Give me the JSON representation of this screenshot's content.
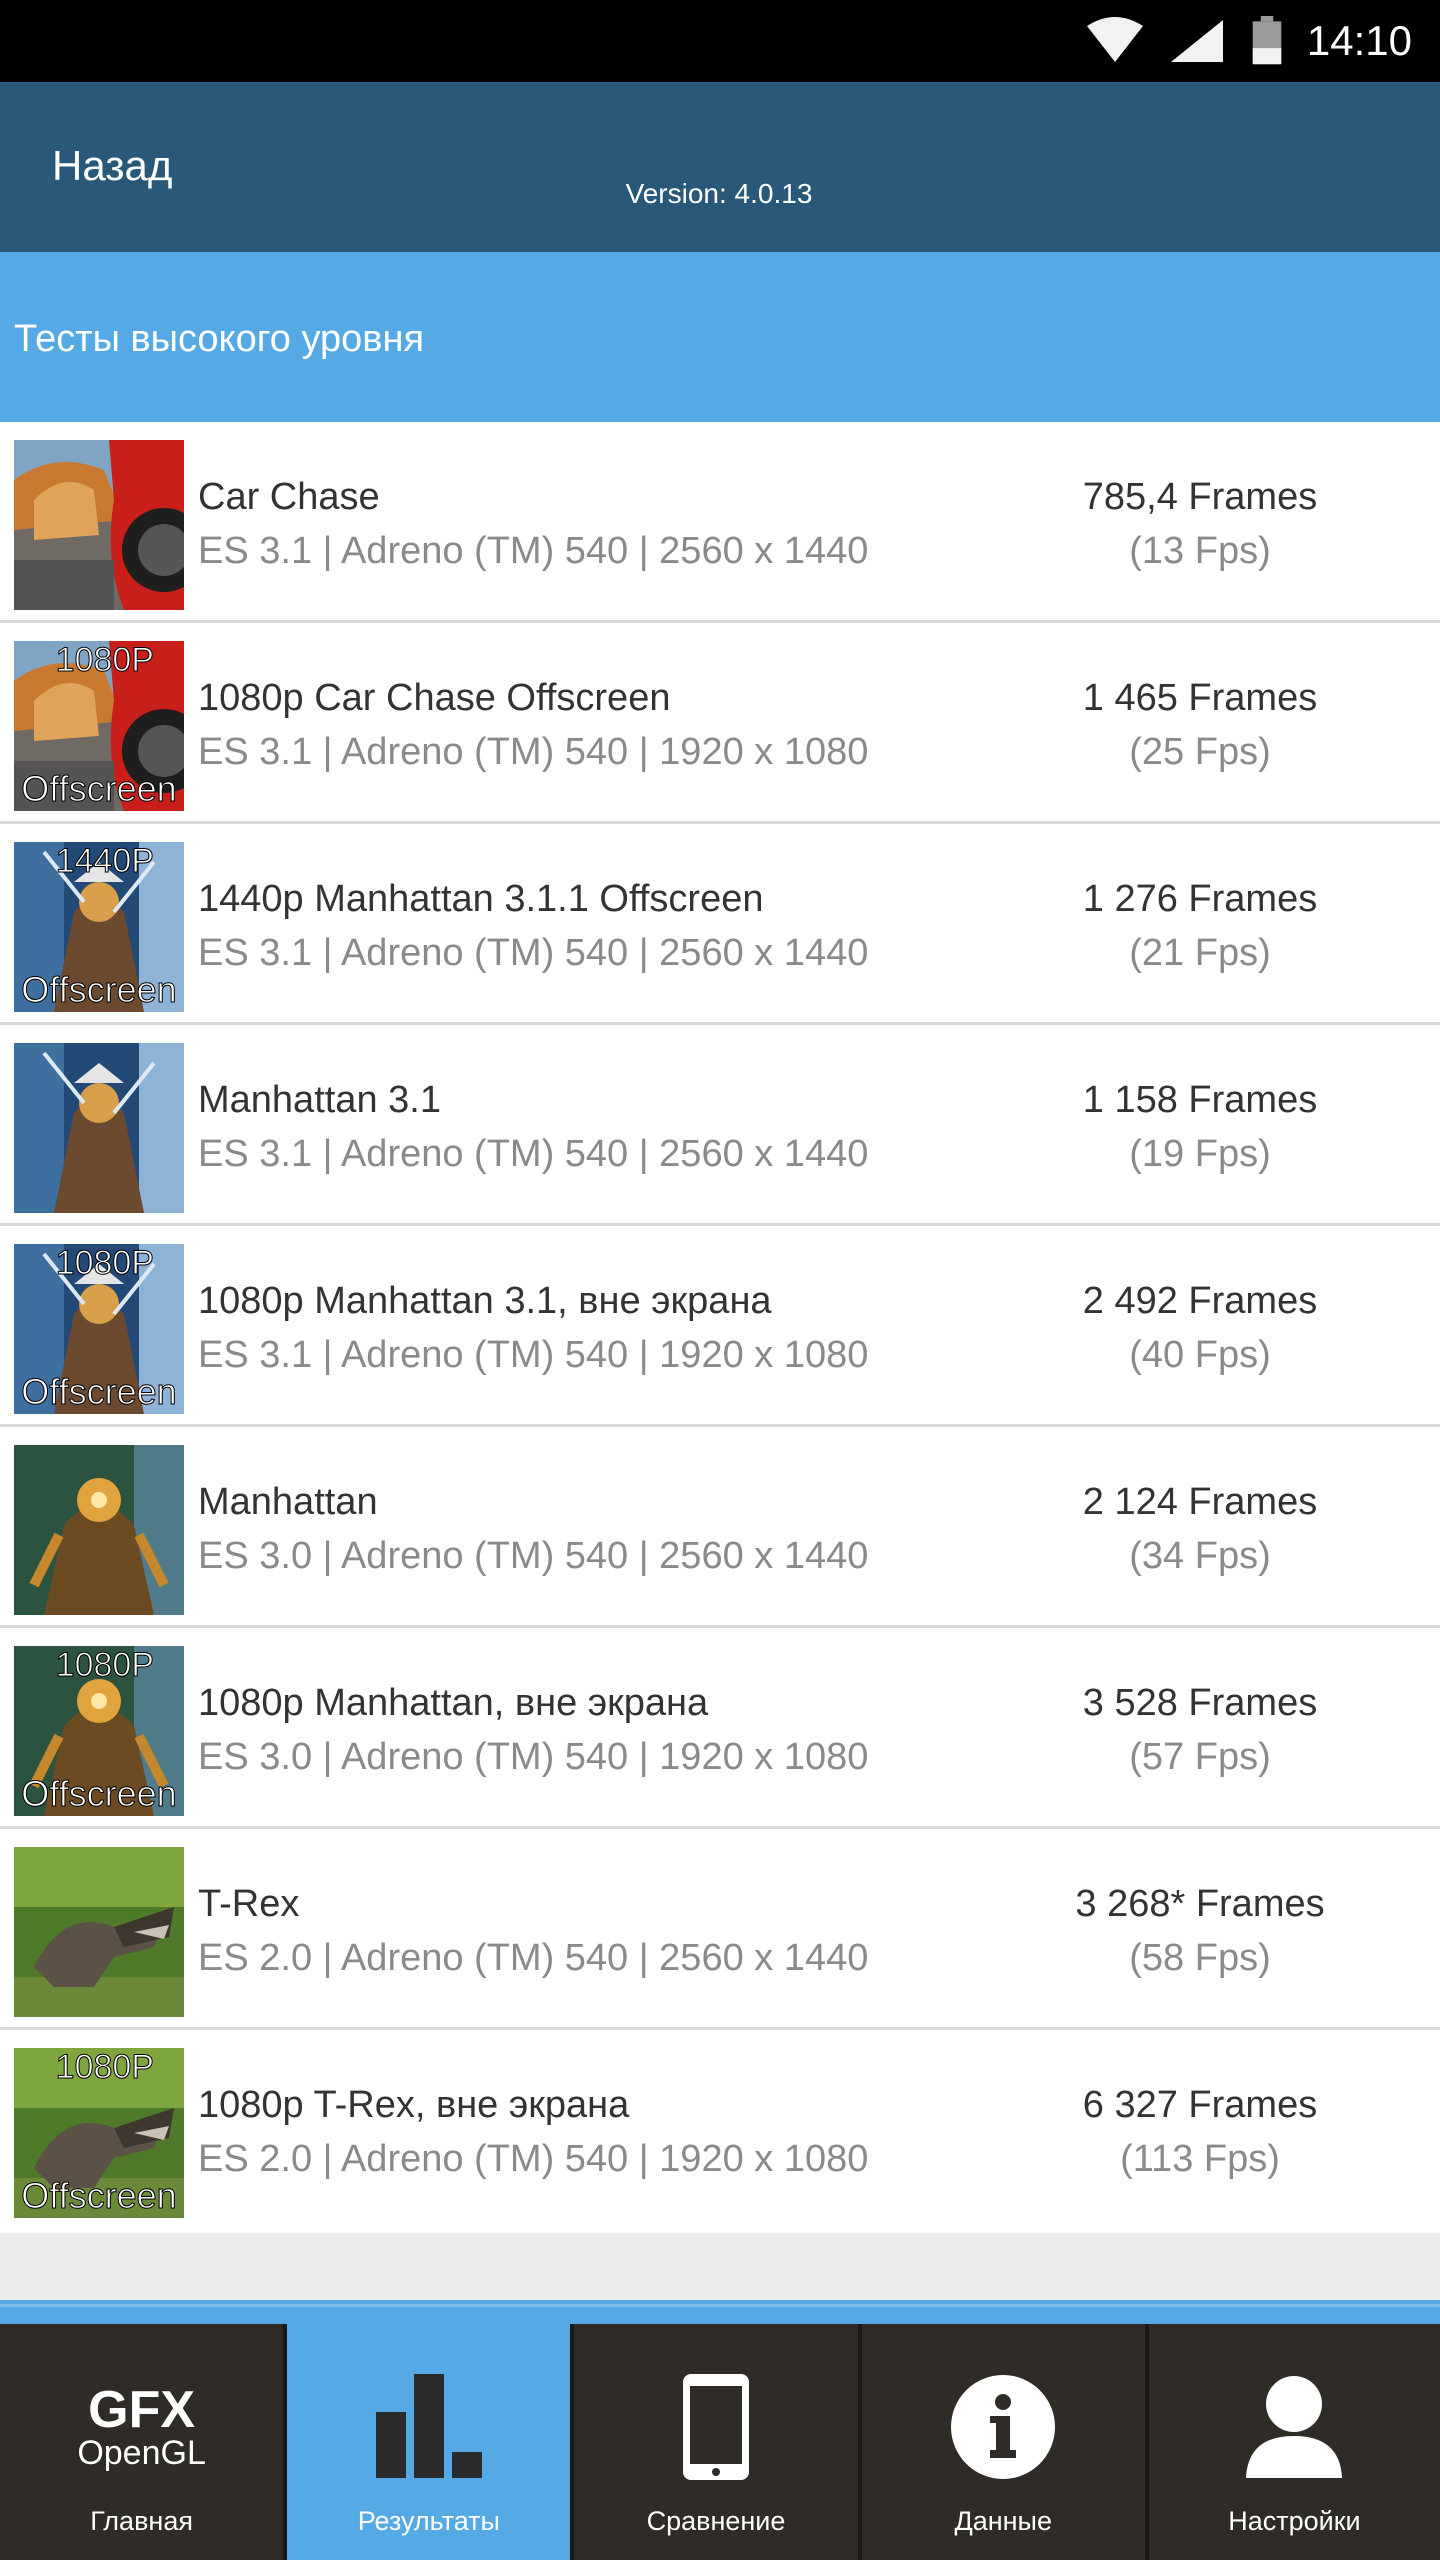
{
  "status_bar": {
    "time": "14:10"
  },
  "header": {
    "back_label": "Назад",
    "version": "Version: 4.0.13"
  },
  "section": {
    "title": "Тесты высокого уровня"
  },
  "results": [
    {
      "title": "Car Chase",
      "subtitle": "ES 3.1 | Adreno (TM) 540 | 2560 x 1440",
      "frames": "785,4 Frames",
      "fps": "(13 Fps)",
      "thumb_badge": "",
      "thumb_theme": "car"
    },
    {
      "title": "1080p Car Chase Offscreen",
      "subtitle": "ES 3.1 | Adreno (TM) 540 | 1920 x 1080",
      "frames": "1 465 Frames",
      "fps": "(25 Fps)",
      "thumb_badge": "1080P",
      "thumb_theme": "car"
    },
    {
      "title": "1440p Manhattan 3.1.1 Offscreen",
      "subtitle": "ES 3.1 | Adreno (TM) 540 | 2560 x 1440",
      "frames": "1 276 Frames",
      "fps": "(21 Fps)",
      "thumb_badge": "1440P",
      "thumb_theme": "robot-blue"
    },
    {
      "title": "Manhattan 3.1",
      "subtitle": "ES 3.1 | Adreno (TM) 540 | 2560 x 1440",
      "frames": "1 158 Frames",
      "fps": "(19 Fps)",
      "thumb_badge": "",
      "thumb_theme": "robot-blue"
    },
    {
      "title": "1080p Manhattan 3.1, вне экрана",
      "subtitle": "ES 3.1 | Adreno (TM) 540 | 1920 x 1080",
      "frames": "2 492 Frames",
      "fps": "(40 Fps)",
      "thumb_badge": "1080P",
      "thumb_theme": "robot-blue"
    },
    {
      "title": "Manhattan",
      "subtitle": "ES 3.0 | Adreno (TM) 540 | 2560 x 1440",
      "frames": "2 124 Frames",
      "fps": "(34 Fps)",
      "thumb_badge": "",
      "thumb_theme": "robot-gold"
    },
    {
      "title": "1080p Manhattan, вне экрана",
      "subtitle": "ES 3.0 | Adreno (TM) 540 | 1920 x 1080",
      "frames": "3 528 Frames",
      "fps": "(57 Fps)",
      "thumb_badge": "1080P",
      "thumb_theme": "robot-gold"
    },
    {
      "title": "T-Rex",
      "subtitle": "ES 2.0 | Adreno (TM) 540 | 2560 x 1440",
      "frames": "3 268* Frames",
      "fps": "(58 Fps)",
      "thumb_badge": "",
      "thumb_theme": "trex"
    },
    {
      "title": "1080p T-Rex, вне экрана",
      "subtitle": "ES 2.0 | Adreno (TM) 540 | 1920 x 1080",
      "frames": "6 327 Frames",
      "fps": "(113 Fps)",
      "thumb_badge": "1080P",
      "thumb_theme": "trex"
    }
  ],
  "thumb_offscreen_label": "Offscreen",
  "bottom_nav": {
    "logo_top": "GFX",
    "logo_bottom": "OpenGL",
    "items": [
      {
        "label": "Главная",
        "icon": "gfx-logo-icon"
      },
      {
        "label": "Результаты",
        "icon": "bar-chart-icon"
      },
      {
        "label": "Сравнение",
        "icon": "phone-icon"
      },
      {
        "label": "Данные",
        "icon": "info-icon"
      },
      {
        "label": "Настройки",
        "icon": "user-icon"
      }
    ],
    "active_index": 1
  },
  "colors": {
    "status_bar": "#000000",
    "top_bar": "#2a5879",
    "accent": "#55aae6",
    "nav_bg": "#2f2c28",
    "divider": "#d9d9d9"
  }
}
